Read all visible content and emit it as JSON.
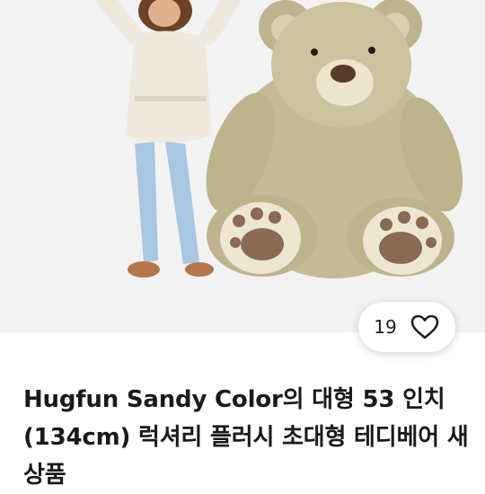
{
  "product": {
    "image_alt": "girl-and-giant-teddy-bear-photo",
    "like_count": "19",
    "title": "Hugfun Sandy Color의 대형 53 인치(134cm) 럭셔리 플러시 초대형 테디베어 새상품"
  },
  "icons": {
    "like": "heart-outline-icon"
  },
  "colors": {
    "background": "#ffffff",
    "photo_background": "#f2f2f2",
    "bear_fur": "#c3bb96",
    "title_text": "#1a1a1a"
  }
}
